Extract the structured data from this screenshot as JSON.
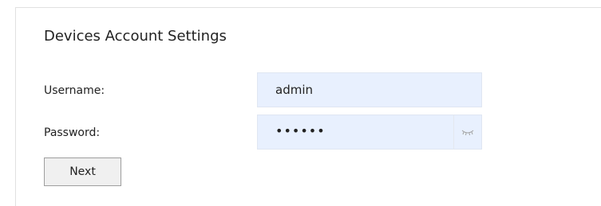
{
  "form": {
    "title": "Devices Account Settings",
    "username": {
      "label": "Username:",
      "value": "admin"
    },
    "password": {
      "label": "Password:",
      "masked_value": "••••••",
      "toggle_icon": "eye-closed-icon"
    },
    "next_label": "Next"
  },
  "colors": {
    "input_background": "#e8f0fe",
    "button_background": "#f0f0f0"
  }
}
